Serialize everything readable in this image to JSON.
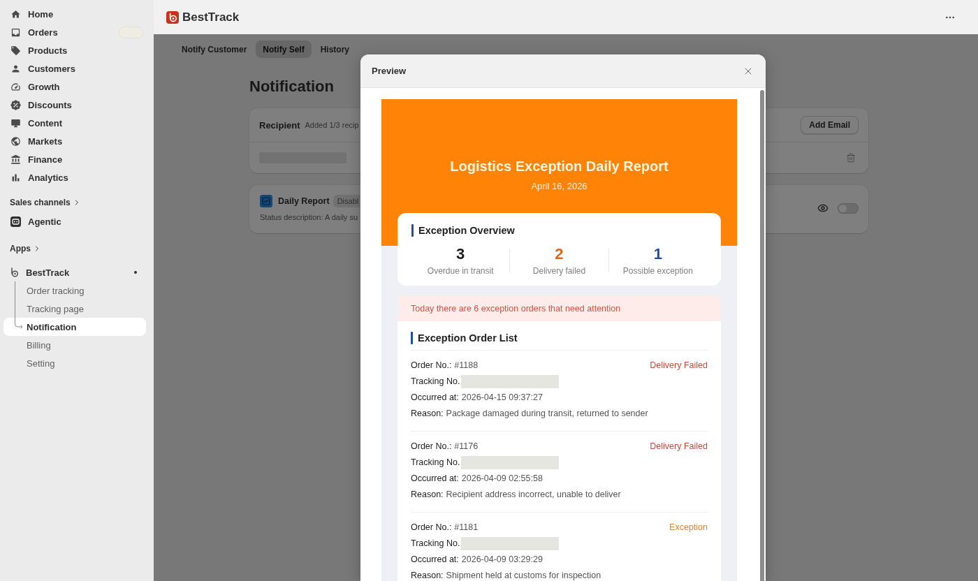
{
  "sidebar": {
    "nav": [
      {
        "label": "Home",
        "selected": false,
        "redacted_badge": false
      },
      {
        "label": "Orders",
        "selected": false,
        "redacted_badge": true
      },
      {
        "label": "Products",
        "selected": false,
        "redacted_badge": false
      },
      {
        "label": "Customers",
        "selected": false,
        "redacted_badge": false
      },
      {
        "label": "Growth",
        "selected": false,
        "redacted_badge": false
      },
      {
        "label": "Discounts",
        "selected": false,
        "redacted_badge": false
      },
      {
        "label": "Content",
        "selected": false,
        "redacted_badge": false
      },
      {
        "label": "Markets",
        "selected": false,
        "redacted_badge": false
      },
      {
        "label": "Finance",
        "selected": false,
        "redacted_badge": false
      },
      {
        "label": "Analytics",
        "selected": false,
        "redacted_badge": false
      }
    ],
    "sales_channels": {
      "label": "Sales channels",
      "items": [
        {
          "label": "Agentic",
          "selected": false
        }
      ]
    },
    "apps": {
      "label": "Apps",
      "items": [
        {
          "label": "BestTrack",
          "selected": false,
          "dot": true,
          "children": [
            {
              "label": "Order tracking",
              "selected": false
            },
            {
              "label": "Tracking page",
              "selected": false
            },
            {
              "label": "Notification",
              "selected": true
            },
            {
              "label": "Billing",
              "selected": false
            },
            {
              "label": "Setting",
              "selected": false
            }
          ]
        }
      ]
    }
  },
  "header": {
    "app_name": "BestTrack"
  },
  "page": {
    "tabs": [
      {
        "label": "Notify Customer",
        "selected": false
      },
      {
        "label": "Notify Self",
        "selected": true
      },
      {
        "label": "History",
        "selected": false
      }
    ],
    "title": "Notification",
    "recipient_card": {
      "title": "Recipient",
      "note": "Added 1/3 recip",
      "button": "Add Email",
      "recipients": [
        {
          "redacted": true
        }
      ]
    },
    "report_card": {
      "title": "Daily Report",
      "badge": "Disabl",
      "description": "Status description: A daily su",
      "enabled": false
    }
  },
  "modal": {
    "title": "Preview",
    "report": {
      "title": "Logistics Exception Daily Report",
      "date": "April 16, 2026",
      "overview": {
        "title": "Exception Overview",
        "stats": [
          {
            "value": "3",
            "label": "Overdue in transit",
            "color": "#1a1a1a"
          },
          {
            "value": "2",
            "label": "Delivery failed",
            "color": "#e0661e"
          },
          {
            "value": "1",
            "label": "Possible exception",
            "color": "#1f4fa5"
          }
        ]
      },
      "alert": "Today there are 6 exception orders that need attention",
      "list_title": "Exception Order List",
      "orders": [
        {
          "order_label": "Order No.:",
          "order_no": "#1188",
          "status": "Delivery Failed",
          "color": "#c84a3e",
          "tracking_label": "Tracking No.",
          "tracking_redacted": true,
          "occurred_label": "Occurred at:",
          "occurred": "2026-04-15 09:37:27",
          "reason_label": "Reason:",
          "reason": "Package damaged during transit, returned to sender"
        },
        {
          "order_label": "Order No.:",
          "order_no": "#1176",
          "status": "Delivery Failed",
          "color": "#c84a3e",
          "tracking_label": "Tracking No.",
          "tracking_redacted": true,
          "occurred_label": "Occurred at:",
          "occurred": "2026-04-09 02:55:58",
          "reason_label": "Reason:",
          "reason": "Recipient address incorrect, unable to deliver"
        },
        {
          "order_label": "Order No.:",
          "order_no": "#1181",
          "status": "Exception",
          "color": "#e0862c",
          "tracking_label": "Tracking No.",
          "tracking_redacted": true,
          "occurred_label": "Occurred at:",
          "occurred": "2026-04-09 03:29:29",
          "reason_label": "Reason:",
          "reason": "Shipment held at customs for inspection"
        }
      ]
    }
  }
}
